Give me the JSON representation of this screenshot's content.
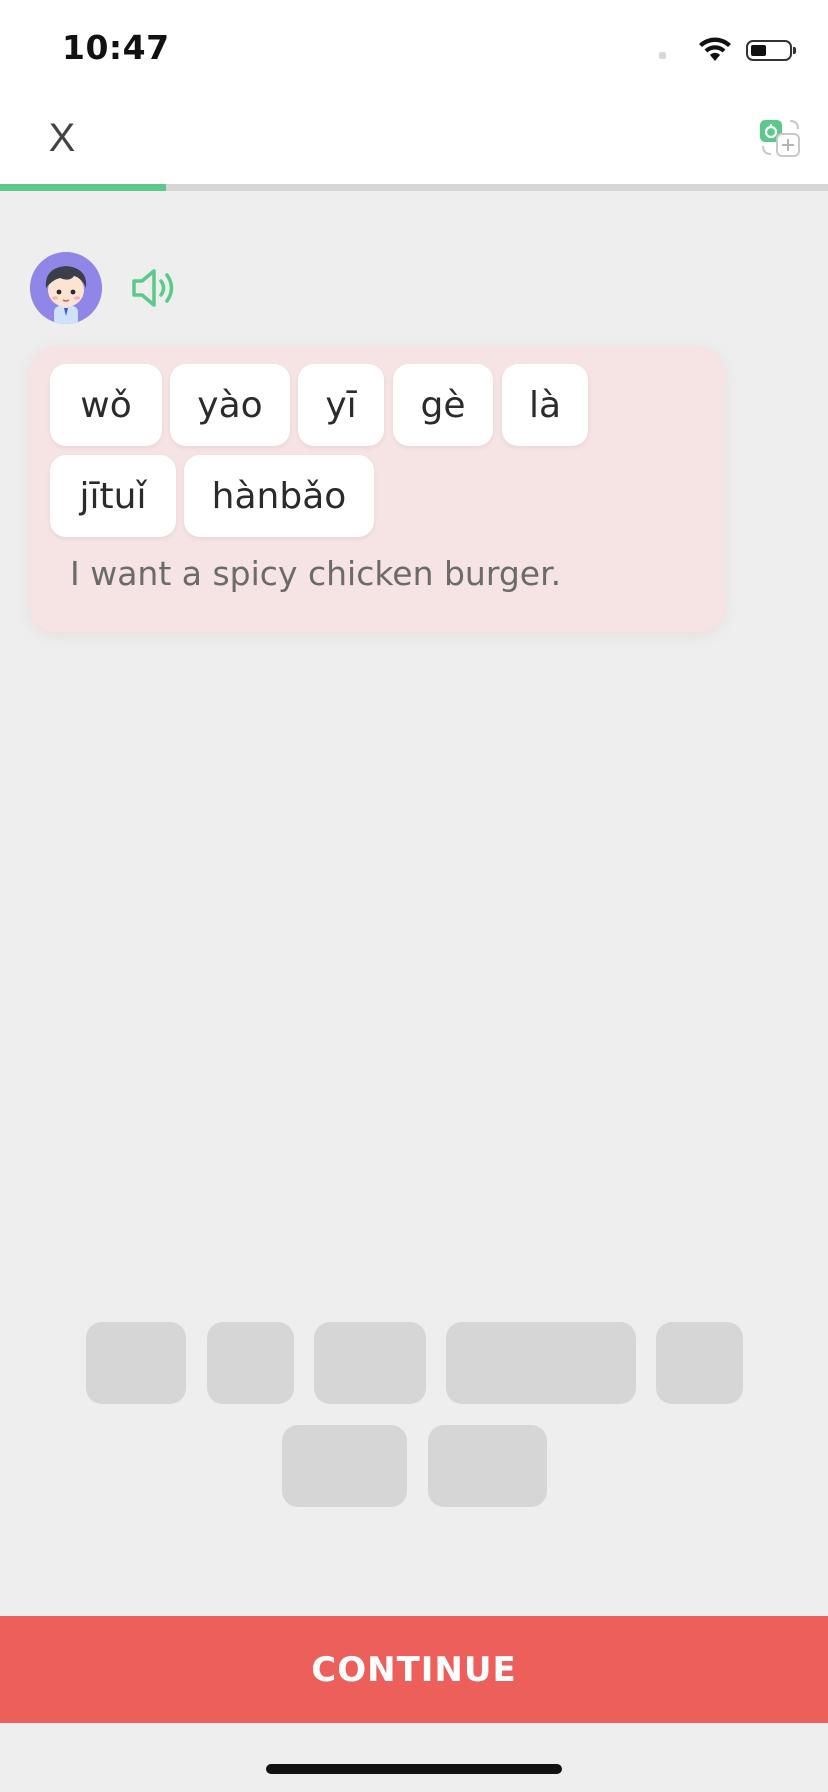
{
  "status": {
    "time": "10:47"
  },
  "header": {
    "close_label": "X"
  },
  "progress": {
    "value": 0.2
  },
  "sentence": {
    "words": [
      "wǒ",
      "yào",
      "yī",
      "gè",
      "là",
      "jītuǐ",
      "hànbǎo"
    ],
    "translation": "I want a spicy chicken burger."
  },
  "answer_slots": {
    "count": 7
  },
  "footer": {
    "continue_label": "CONTINUE"
  },
  "colors": {
    "accent_green": "#5ac98a",
    "button_red": "#ec5f5a",
    "card_pink": "#f6e3e3",
    "avatar_purple": "#8f86e8"
  }
}
